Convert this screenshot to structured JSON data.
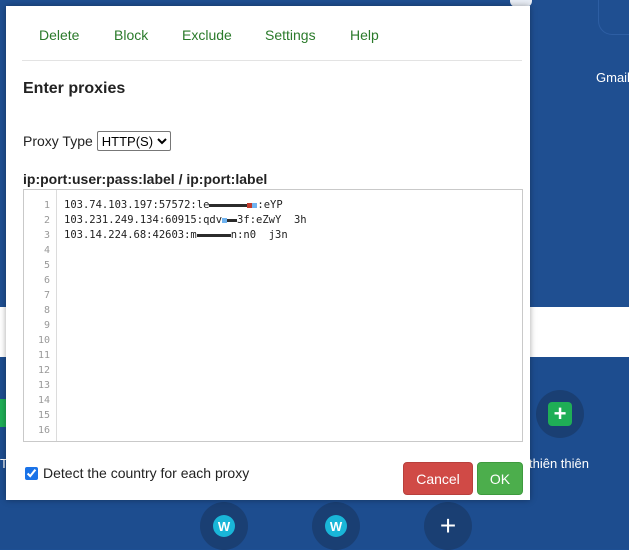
{
  "background": {
    "gmail_label": "Gmail",
    "shortcut_label": "thiên thiên",
    "stub_label": "T"
  },
  "dialog": {
    "menu": [
      "Delete",
      "Block",
      "Exclude",
      "Settings",
      "Help"
    ],
    "title": "Enter proxies",
    "proxy_type_label": "Proxy Type",
    "proxy_type_options": [
      "HTTP(S)"
    ],
    "proxy_type_selected": "HTTP(S)",
    "format_label": "ip:port:user:pass:label / ip:port:label",
    "editor": {
      "line_numbers": [
        "1",
        "2",
        "3",
        "4",
        "5",
        "6",
        "7",
        "8",
        "9",
        "10",
        "11",
        "12",
        "13",
        "14",
        "15",
        "16"
      ],
      "lines": [
        {
          "before": "103.74.103.197:57572:le",
          "after": ":eYP"
        },
        {
          "before": "103.231.249.134:60915:qdv",
          "after": "3f:eZwY  3h"
        },
        {
          "before": "103.14.224.68:42603:m",
          "after": "n:n0  j3n"
        }
      ]
    },
    "detect_label": "Detect the country for each proxy",
    "detect_checked": true,
    "cancel_label": "Cancel",
    "ok_label": "OK"
  },
  "icons": {
    "green_plus": "plus-square-icon",
    "w_logo": "w-logo-icon",
    "white_plus": "plus-icon"
  },
  "colors": {
    "menu_text": "#2a7a2a",
    "cancel_bg": "#d04a46",
    "ok_bg": "#4cae4c",
    "page_bg": "#1d4f93"
  }
}
